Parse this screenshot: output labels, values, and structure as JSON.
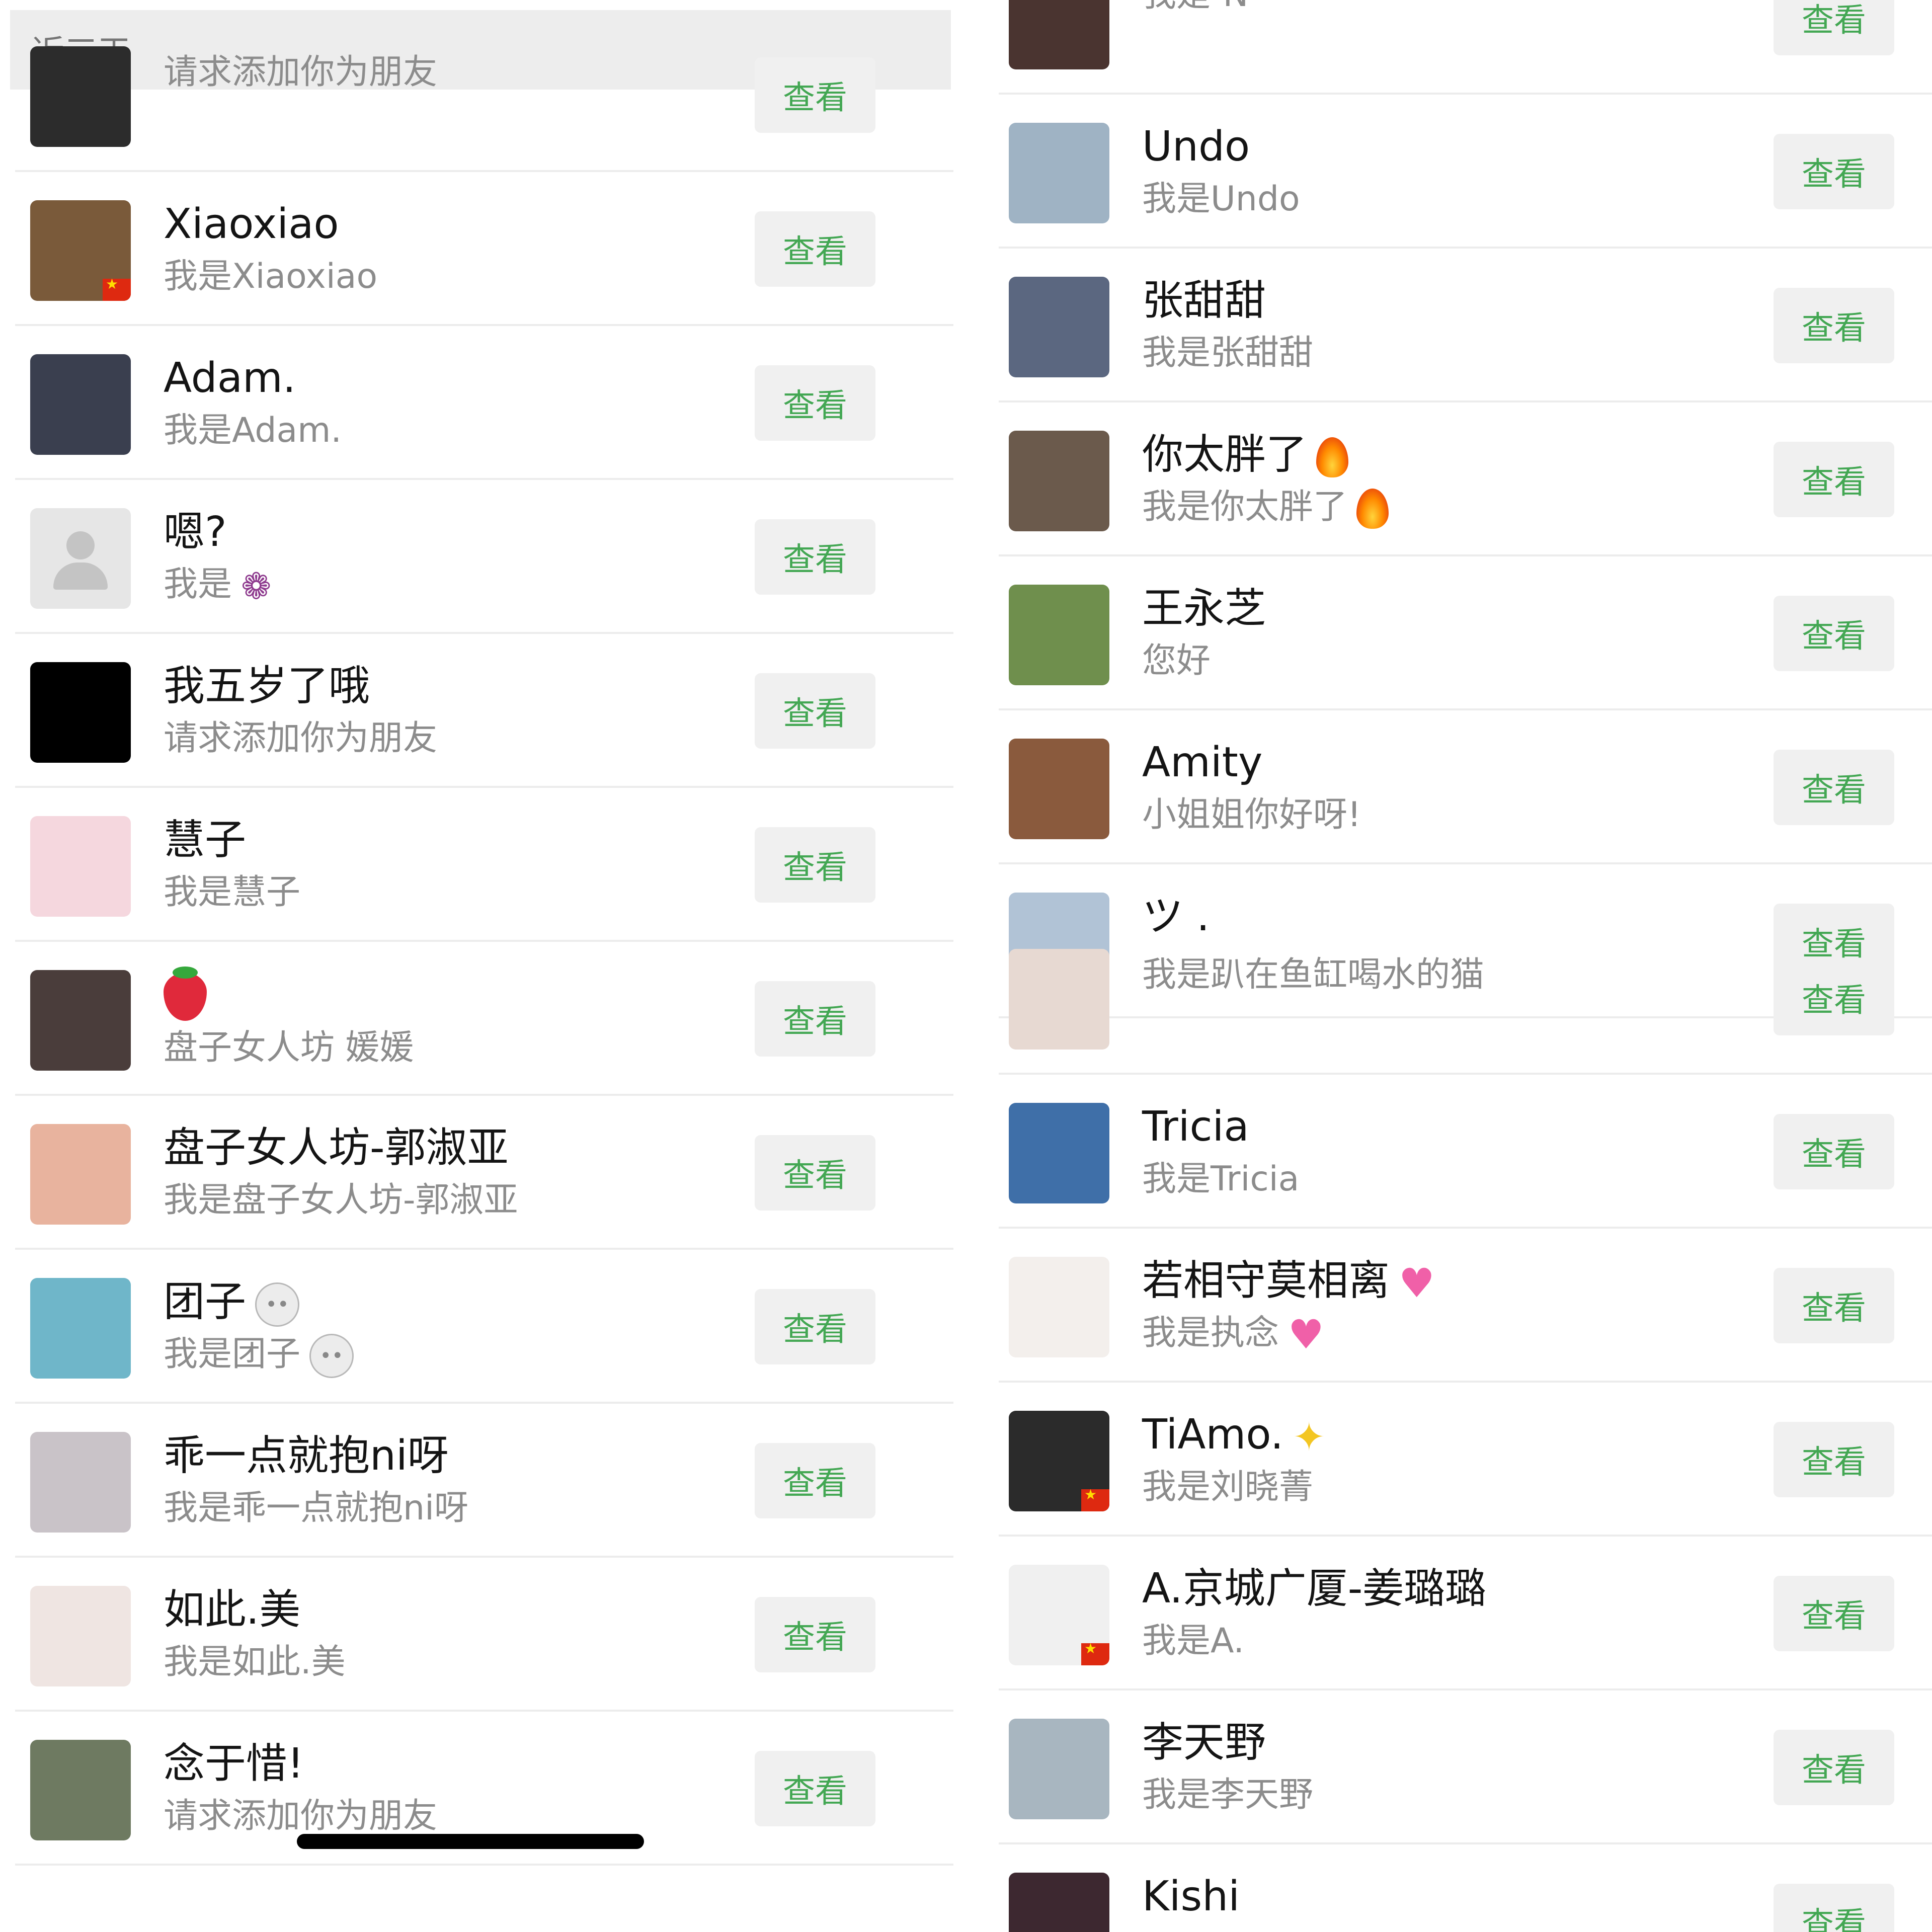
{
  "left": {
    "section_title": "近三天",
    "rows": [
      {
        "name": "",
        "sub": "请求添加你为朋友",
        "button": "查看",
        "avatar": "#2c2c2c"
      },
      {
        "name": "Xiaoxiao",
        "sub": "我是Xiaoxiao",
        "button": "查看",
        "avatar": "#7a5a3a",
        "flag": true
      },
      {
        "name": "Adam.",
        "sub": "我是Adam.",
        "button": "查看",
        "avatar": "#3a3f4f"
      },
      {
        "name": "嗯?",
        "sub": "我是",
        "button": "查看",
        "default_avatar": true,
        "sub_emoji": "grapes"
      },
      {
        "name": "我五岁了哦",
        "sub": "请求添加你为朋友",
        "button": "查看",
        "avatar": "#000000"
      },
      {
        "name": "慧子",
        "sub": "我是慧子",
        "button": "查看",
        "avatar": "#f5d7de"
      },
      {
        "name": "",
        "sub": "盘子女人坊 媛媛",
        "button": "查看",
        "avatar": "#4a3d3b",
        "name_emoji": "strawberry"
      },
      {
        "name": "盘子女人坊-郭淑亚",
        "sub": "我是盘子女人坊-郭淑亚",
        "button": "查看",
        "avatar": "#e8b39e"
      },
      {
        "name": "团子",
        "sub": "我是团子",
        "button": "查看",
        "avatar": "#6fb6c9",
        "name_emoji": "rabbit",
        "sub_emoji": "rabbit"
      },
      {
        "name": "乖一点就抱ni呀",
        "sub": "我是乖一点就抱ni呀",
        "button": "查看",
        "avatar": "#c9c3c8"
      },
      {
        "name": "如此.美",
        "sub": "我是如此.美",
        "button": "查看",
        "avatar": "#efe5e2"
      },
      {
        "name": "念于惜!",
        "sub": "请求添加你为朋友",
        "button": "查看",
        "avatar": "#6e7a61"
      }
    ]
  },
  "right": {
    "rows": [
      {
        "name": "",
        "sub": "我是-N",
        "button": "查看",
        "avatar": "#4a3430"
      },
      {
        "name": "Undo",
        "sub": "我是Undo",
        "button": "查看",
        "avatar": "#9fb3c4"
      },
      {
        "name": "张甜甜",
        "sub": "我是张甜甜",
        "button": "查看",
        "avatar": "#5b6780"
      },
      {
        "name": "你太胖了",
        "sub": "我是你太胖了",
        "button": "查看",
        "avatar": "#6b5a4c",
        "name_emoji": "fire",
        "sub_emoji": "fire"
      },
      {
        "name": "王永芝",
        "sub": "您好",
        "button": "查看",
        "avatar": "#6f8f4d"
      },
      {
        "name": "Amity",
        "sub": "小姐姐你好呀!",
        "button": "查看",
        "avatar": "#8a5a3d"
      },
      {
        "name": "ツ .",
        "sub": "",
        "button": "查看",
        "avatar": "#b1c3d6"
      },
      {
        "name": "",
        "sub": "我是趴在鱼缸喝水的猫",
        "button": "查看",
        "avatar": "#e7d9d2"
      },
      {
        "name": "Tricia",
        "sub": "我是Tricia",
        "button": "查看",
        "avatar": "#3f6fa8"
      },
      {
        "name": "若相守莫相离",
        "sub": "我是执念",
        "button": "查看",
        "avatar": "#f3efec",
        "name_emoji": "heart",
        "sub_emoji": "heart"
      },
      {
        "name": "TiAmo.",
        "sub": "我是刘晓菁",
        "button": "查看",
        "avatar": "#2b2b2b",
        "name_emoji": "sparkle",
        "flag": true
      },
      {
        "name": "A.京城广厦-姜璐璐",
        "sub": "我是A.",
        "button": "查看",
        "avatar": "#f0f0f0",
        "flag": true
      },
      {
        "name": "李天野",
        "sub": "我是李天野",
        "button": "查看",
        "avatar": "#a8b6c0"
      },
      {
        "name": "Kishi",
        "sub": "",
        "button": "查看",
        "avatar": "#3d2830"
      }
    ]
  }
}
